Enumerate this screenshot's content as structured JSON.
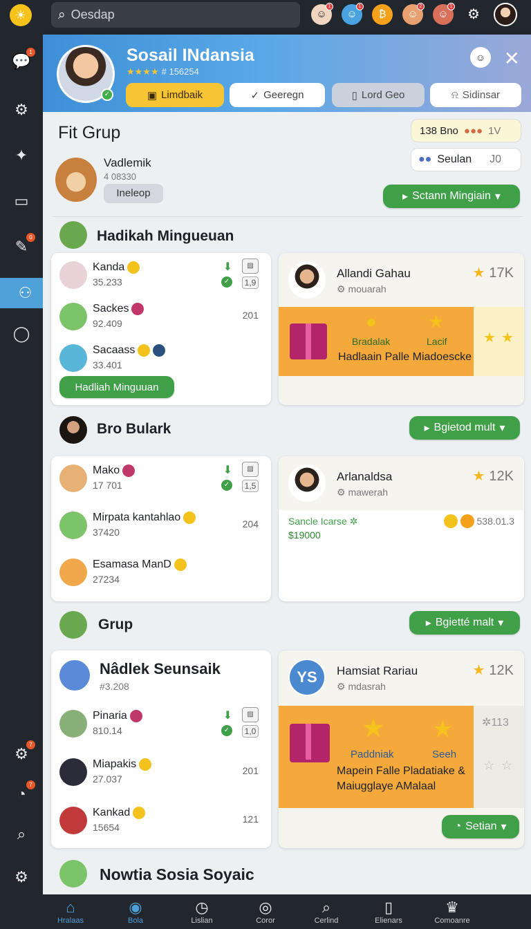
{
  "topbar": {
    "search_placeholder": "Oesdap",
    "icons": [
      "sun-logo-icon",
      "avatar-1-icon",
      "avatar-2-icon",
      "coin-icon",
      "avatar-3-icon",
      "avatar-4-icon",
      "gear-icon",
      "profile-avatar-icon"
    ]
  },
  "header": {
    "title": "Sosail INdansia",
    "subtitle": "# 156254",
    "stars": "★★★★",
    "buttons": [
      "Limdbaik",
      "Geeregn",
      "Lord Geo",
      "Sidinsar"
    ]
  },
  "group": {
    "title": "Fit Grup",
    "member_name": "Vadlemik",
    "member_id": "4 08330",
    "member_tag": "Ineleop",
    "badge1": "138 Bno",
    "badge1_extra": "1V",
    "badge2": "Seulan",
    "badge2_extra": "J0",
    "action_button": "Sctann Mingiain"
  },
  "section1": {
    "title": "Hadikah Mingueuan",
    "rows": [
      {
        "name": "Kanda",
        "score": "35.233",
        "num": "1,9"
      },
      {
        "name": "Sackes",
        "score": "92.409",
        "num": "201"
      },
      {
        "name": "Sacaass",
        "score": "33.401",
        "num": ""
      }
    ],
    "button": "Hadliah Minguuan",
    "card": {
      "name": "Allandi Gahau",
      "sub": "mouarah",
      "rating": "17K",
      "promo_label1": "Bradalak",
      "promo_label2": "Lacif",
      "promo_text": "Hadlaain Palle Miadoescke"
    }
  },
  "section2": {
    "title": "Bro Bulark",
    "button": "Bgietod mult",
    "rows": [
      {
        "name": "Mako",
        "score": "17 701",
        "num": "1,5"
      },
      {
        "name": "Mirpata kantahlao",
        "score": "37420",
        "num": "204"
      },
      {
        "name": "Esamasa ManD",
        "score": "27234",
        "num": ""
      }
    ],
    "card": {
      "name": "Arlanaldsa",
      "sub": "mawerah",
      "rating": "12K",
      "line1": "Sancle Icarse",
      "line2": "$19000",
      "value": "538.01.3"
    }
  },
  "section3": {
    "title": "Grup",
    "button": "Bgietté malt",
    "list_title": "Nâdlek Seunsaik",
    "list_sub": "#3.208",
    "rows": [
      {
        "name": "Pinaria",
        "score": "810.14",
        "num": "1,0"
      },
      {
        "name": "Miapakis",
        "score": "27.037",
        "num": "201"
      },
      {
        "name": "Kankad",
        "score": "15654",
        "num": "121"
      }
    ],
    "card": {
      "logo": "YS",
      "name": "Hamsiat Rariau",
      "sub": "mdasrah",
      "rating": "12K",
      "side_value": "113",
      "promo_label1": "Paddniak",
      "promo_label2": "Seeh",
      "promo_text": "Mapein Falle Pladatiake & Maiugglaye AMalaal",
      "button": "Setian"
    }
  },
  "section4": {
    "title": "Nowtia Sosia Soyaic"
  },
  "bottom_nav": [
    {
      "label": "Hralaas",
      "icon": "home-icon"
    },
    {
      "label": "Bola",
      "icon": "pin-icon"
    },
    {
      "label": "Lislian",
      "icon": "clock-icon"
    },
    {
      "label": "Coror",
      "icon": "compass-icon"
    },
    {
      "label": "Cerlind",
      "icon": "search-icon"
    },
    {
      "label": "Elienars",
      "icon": "phone-icon"
    },
    {
      "label": "Comoanre",
      "icon": "crown-icon"
    }
  ],
  "colors": {
    "accent": "#4da0d8",
    "green": "#3fa048",
    "promo": "#f4a93a",
    "star": "#f6c21c"
  }
}
